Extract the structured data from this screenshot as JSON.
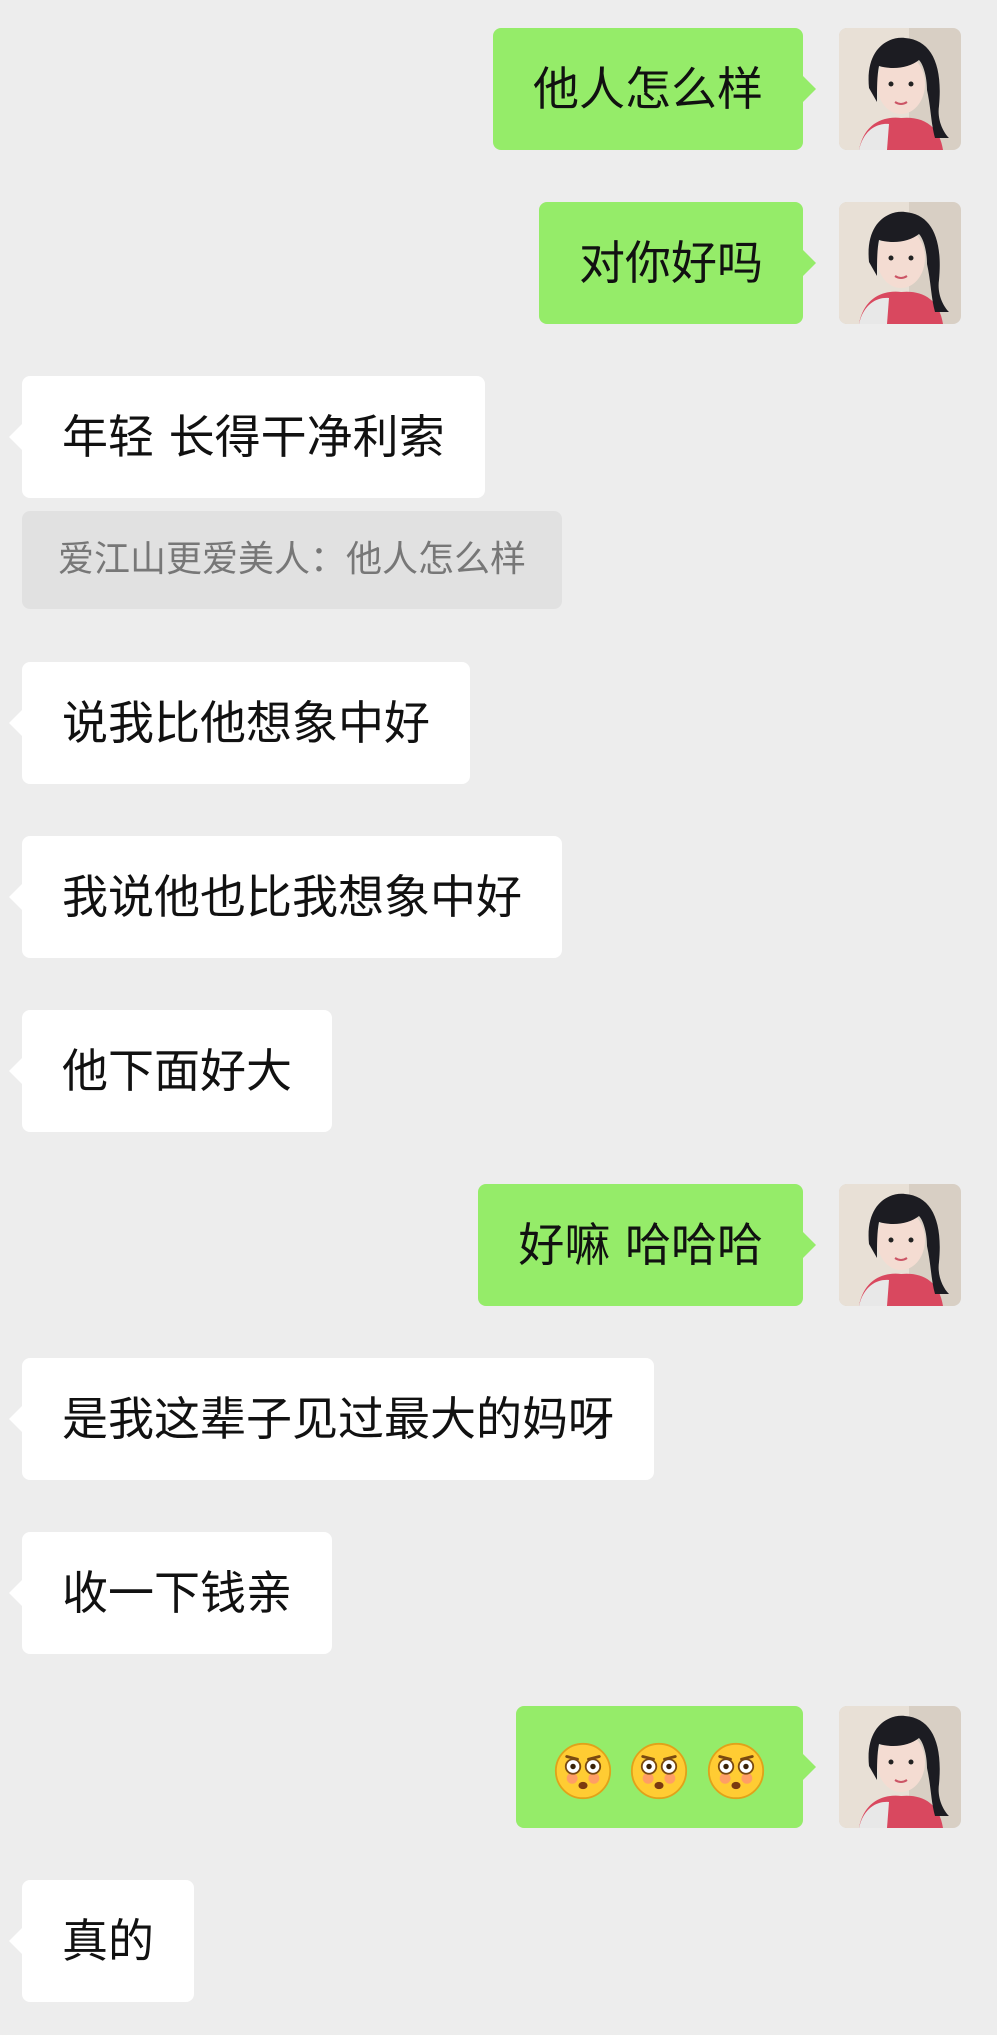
{
  "messages": [
    {
      "side": "right",
      "text": "他人怎么样"
    },
    {
      "side": "right",
      "text": "对你好吗"
    },
    {
      "side": "left",
      "text": "年轻 长得干净利索"
    },
    {
      "quote": "爱江山更爱美人：他人怎么样"
    },
    {
      "side": "left",
      "text": "说我比他想象中好"
    },
    {
      "side": "left",
      "text": "我说他也比我想象中好"
    },
    {
      "side": "left",
      "text": "他下面好大"
    },
    {
      "side": "right",
      "text": "好嘛 哈哈哈"
    },
    {
      "side": "left",
      "text": "是我这辈子见过最大的妈呀"
    },
    {
      "side": "left",
      "text": "收一下钱亲"
    },
    {
      "side": "right",
      "emojis": [
        "flushed-face",
        "flushed-face",
        "flushed-face"
      ]
    },
    {
      "side": "left",
      "text": "真的"
    }
  ],
  "colors": {
    "background": "#ededed",
    "my_bubble": "#95ec69",
    "other_bubble": "#ffffff",
    "quote_bg": "#e1e1e1",
    "quote_text": "#777777"
  }
}
